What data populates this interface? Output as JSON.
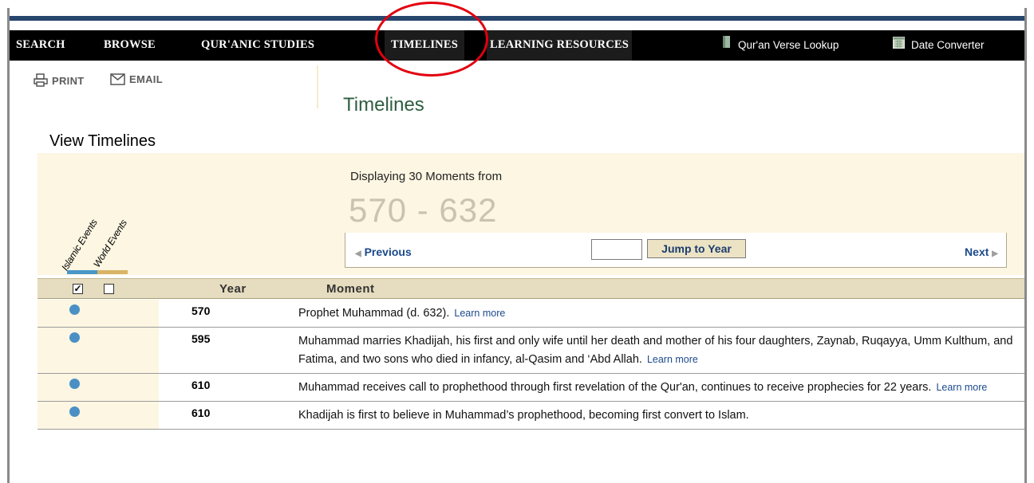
{
  "nav": {
    "items": [
      "SEARCH",
      "BROWSE",
      "QUR'ANIC STUDIES",
      "TIMELINES",
      "LEARNING RESOURCES"
    ],
    "tools": [
      {
        "label": "Qur'an Verse Lookup",
        "icon": "book-icon"
      },
      {
        "label": "Date Converter",
        "icon": "calendar-icon"
      }
    ]
  },
  "utils": {
    "print": "PRINT",
    "email": "EMAIL"
  },
  "page": {
    "title": "Timelines",
    "side_title": "View Timelines"
  },
  "filters": {
    "islamic_label": "Islamic Events",
    "world_label": "World Events",
    "islamic_checked": true,
    "world_checked": false,
    "islamic_color": "#4a96c8",
    "world_color": "#d9b466"
  },
  "display": {
    "caption": "Displaying 30 Moments from",
    "range": "570 - 632",
    "previous": "Previous",
    "next": "Next",
    "jump_label": "Jump to Year",
    "year_input_value": ""
  },
  "table": {
    "headers": {
      "year": "Year",
      "moment": "Moment"
    },
    "learn_more": "Learn more",
    "rows": [
      {
        "year": "570",
        "moment": "Prophet Muhammad (d. 632).",
        "learn_more": true
      },
      {
        "year": "595",
        "moment": "Muhammad marries Khadijah, his first and only wife until her death and mother of his four daughters, Zaynab, Ruqayya, Umm Kulthum, and Fatima, and two sons who died in infancy, al-Qasim and ‘Abd Allah.",
        "learn_more": true
      },
      {
        "year": "610",
        "moment": "Muhammad receives call to prophethood through first revelation of the Qur'an, continues to receive prophecies for 22 years.",
        "learn_more": true
      },
      {
        "year": "610",
        "moment": "Khadijah is first to believe in Muhammad’s prophethood, becoming first convert to Islam.",
        "learn_more": false
      }
    ]
  }
}
